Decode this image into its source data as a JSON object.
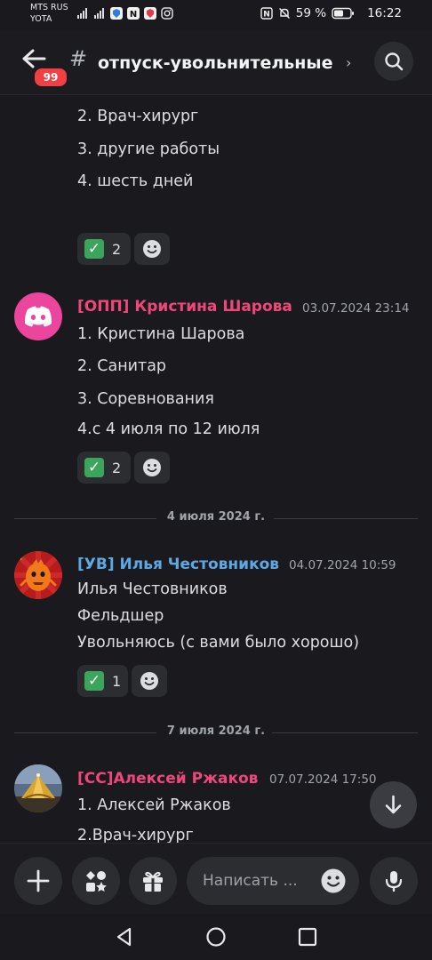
{
  "status_bar": {
    "carrier_line1": "MTS RUS",
    "carrier_line2": "YOTA",
    "battery": "59 %",
    "time": "16:22"
  },
  "header": {
    "back_badge": "99",
    "channel_icon": "#",
    "channel_name": "отпуск-увольнительные",
    "chevron": "›"
  },
  "messages": [
    {
      "lines": [
        "2.  Врач-хирург",
        "3.  другие работы",
        "4.  шесть дней"
      ],
      "reaction": {
        "emoji": "✓",
        "count": "2"
      }
    },
    {
      "username": "[ОПП] Кристина Шарова",
      "username_color": "#f0477a",
      "timestamp": "03.07.2024 23:14",
      "avatar": "discord-logo-pink",
      "lines": [
        "1.  Кристина Шарова",
        "2.  Санитар",
        "3.  Соревнования",
        "4.с 4 июля по 12 июля"
      ],
      "reaction": {
        "emoji": "✓",
        "count": "2"
      }
    },
    {
      "date_divider": "4 июля 2024 г."
    },
    {
      "username": "[УВ] Илья Честовников",
      "username_color": "#5ca9e6",
      "timestamp": "04.07.2024 10:59",
      "avatar": "orange-character",
      "lines": [
        "Илья Честовников",
        "Фельдшер",
        "Увольняюсь (с вами было хорошо)"
      ],
      "reaction": {
        "emoji": "✓",
        "count": "1"
      }
    },
    {
      "date_divider": "7 июля 2024 г."
    },
    {
      "username": "[СС]Алексей Ржаков",
      "username_color": "#f0477a",
      "timestamp": "07.07.2024 17:50",
      "avatar": "golden-tent-landscape",
      "lines": [
        "1.  Алексей Ржаков",
        "2.Врач-хирург"
      ]
    }
  ],
  "composer": {
    "placeholder": "Написать ..."
  },
  "colors": {
    "background": "#1a1a1e",
    "reaction_bg": "#2b2d31",
    "check_green": "#3ba55c",
    "badge_red": "#f23f43"
  }
}
